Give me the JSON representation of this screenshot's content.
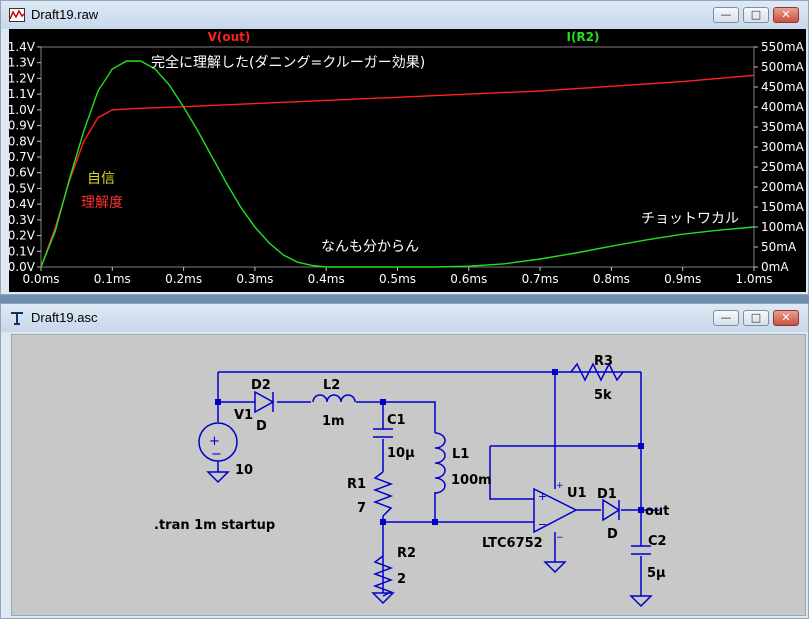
{
  "waveform_window": {
    "title": "Draft19.raw",
    "buttons": {
      "minimize": "—",
      "maximize": "□",
      "close": "✕"
    },
    "trace_names": [
      {
        "label": "V(out)",
        "color": "#ff2020"
      },
      {
        "label": "I(R2)",
        "color": "#20e020"
      }
    ],
    "annotations": {
      "title_text": "完全に理解した(ダニング=クルーガー効果)",
      "confidence": "自信",
      "understanding": "理解度",
      "dont_know": "なんも分からん",
      "somewhat": "チョットワカル"
    }
  },
  "chart_data": {
    "type": "line",
    "x_ticks": [
      "0.0ms",
      "0.1ms",
      "0.2ms",
      "0.3ms",
      "0.4ms",
      "0.5ms",
      "0.6ms",
      "0.7ms",
      "0.8ms",
      "0.9ms",
      "1.0ms"
    ],
    "y_left_ticks": [
      "1.4V",
      "1.3V",
      "1.2V",
      "1.1V",
      "1.0V",
      "0.9V",
      "0.8V",
      "0.7V",
      "0.6V",
      "0.5V",
      "0.4V",
      "0.3V",
      "0.2V",
      "0.1V",
      "0.0V"
    ],
    "y_right_ticks": [
      "550mA",
      "500mA",
      "450mA",
      "400mA",
      "350mA",
      "300mA",
      "250mA",
      "200mA",
      "150mA",
      "100mA",
      "50mA",
      "0mA"
    ],
    "xlim": [
      0,
      1.0
    ],
    "ylim_left": [
      0,
      1.4
    ],
    "ylim_right": [
      0,
      550
    ],
    "series": [
      {
        "name": "V(out)",
        "axis": "left",
        "color": "#ff2020",
        "x": [
          0.0,
          0.02,
          0.04,
          0.06,
          0.08,
          0.1,
          0.12,
          0.14,
          0.2,
          0.3,
          0.4,
          0.5,
          0.6,
          0.7,
          0.8,
          0.9,
          1.0
        ],
        "y": [
          0.0,
          0.25,
          0.55,
          0.8,
          0.95,
          1.0,
          1.005,
          1.01,
          1.02,
          1.04,
          1.06,
          1.08,
          1.1,
          1.12,
          1.15,
          1.18,
          1.22
        ]
      },
      {
        "name": "I(R2)",
        "axis": "right",
        "color": "#20e020",
        "x": [
          0.0,
          0.02,
          0.04,
          0.06,
          0.08,
          0.1,
          0.12,
          0.14,
          0.16,
          0.18,
          0.2,
          0.22,
          0.24,
          0.26,
          0.28,
          0.3,
          0.32,
          0.34,
          0.36,
          0.38,
          0.4,
          0.45,
          0.5,
          0.55,
          0.6,
          0.65,
          0.7,
          0.75,
          0.8,
          0.85,
          0.9,
          0.95,
          1.0
        ],
        "y": [
          0,
          90,
          220,
          340,
          440,
          495,
          515,
          515,
          495,
          455,
          400,
          340,
          275,
          210,
          150,
          100,
          60,
          30,
          12,
          4,
          0,
          0,
          0,
          0,
          2,
          8,
          20,
          35,
          52,
          68,
          82,
          92,
          100
        ]
      }
    ]
  },
  "schematic_window": {
    "title": "Draft19.asc",
    "buttons": {
      "minimize": "—",
      "maximize": "□",
      "close": "✕"
    },
    "directive": ".tran 1m startup",
    "components": {
      "R3": {
        "name": "R3",
        "value": "5k"
      },
      "D2": {
        "name": "D2",
        "value": "D"
      },
      "V1": {
        "name": "V1",
        "value": "10"
      },
      "L2": {
        "name": "L2",
        "value": "1m"
      },
      "C1": {
        "name": "C1",
        "value": "10μ"
      },
      "L1": {
        "name": "L1",
        "value": "100m"
      },
      "R1": {
        "name": "R1",
        "value": "7"
      },
      "R2": {
        "name": "R2",
        "value": "2"
      },
      "U1": {
        "name": "U1",
        "value": "LTC6752"
      },
      "D1": {
        "name": "D1",
        "value": "D"
      },
      "C2": {
        "name": "C2",
        "value": "5μ"
      },
      "out_label": "out"
    }
  }
}
